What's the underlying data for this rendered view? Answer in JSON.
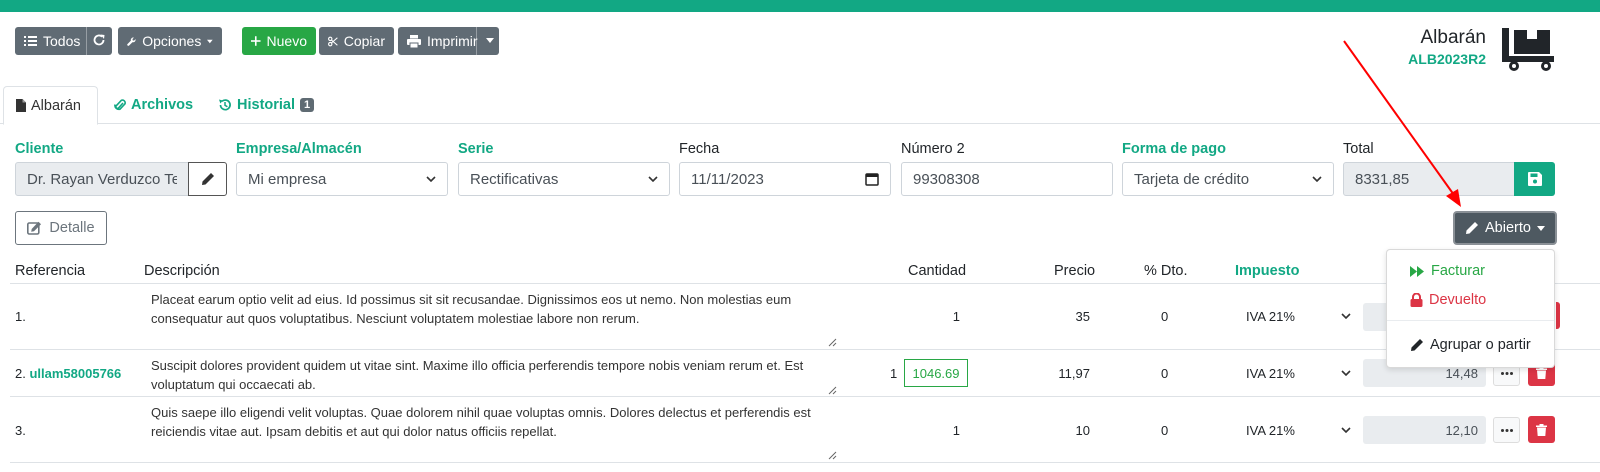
{
  "toolbar": {
    "all_label": "Todos",
    "options_label": "Opciones",
    "new_label": "Nuevo",
    "copy_label": "Copiar",
    "print_label": "Imprimir"
  },
  "document": {
    "type": "Albarán",
    "code": "ALB2023R2"
  },
  "tabs": [
    {
      "label": "Albarán"
    },
    {
      "label": "Archivos"
    },
    {
      "label": "Historial",
      "badge": "1"
    }
  ],
  "form": {
    "cliente_label": "Cliente",
    "cliente_value": "Dr. Rayan Verduzco Te",
    "empresa_label": "Empresa/Almacén",
    "empresa_value": "Mi empresa",
    "serie_label": "Serie",
    "serie_value": "Rectificativas",
    "fecha_label": "Fecha",
    "fecha_value": "11/11/2023",
    "numero2_label": "Número 2",
    "numero2_value": "99308308",
    "pago_label": "Forma de pago",
    "pago_value": "Tarjeta de crédito",
    "total_label": "Total",
    "total_value": "8331,85"
  },
  "detalle_label": "Detalle",
  "status_label": "Abierto",
  "columns": {
    "referencia": "Referencia",
    "descripcion": "Descripción",
    "cantidad": "Cantidad",
    "precio": "Precio",
    "dto": "% Dto.",
    "impuesto": "Impuesto"
  },
  "lines": [
    {
      "index": "1.",
      "ref": "",
      "desc": "Placeat earum optio velit ad eius. Id possimus sit sit recusandae. Dignissimos eos ut nemo. Non molestias eum consequatur aut quos voluptatibus. Nesciunt voluptatem molestiae labore non rerum.",
      "cantidad": "1",
      "precio": "35",
      "dto": "0",
      "impuesto": "IVA 21%",
      "total": ""
    },
    {
      "index": "2.",
      "ref": "ullam58005766",
      "desc": "Suscipit dolores provident quidem ut vitae sint. Maxime illo officia perferendis tempore nobis veniam rerum et. Est voluptatum qui occaecati ab.",
      "cantidad": "1",
      "stock": "1046.69",
      "precio": "11,97",
      "dto": "0",
      "impuesto": "IVA 21%",
      "total": "14,48"
    },
    {
      "index": "3.",
      "ref": "",
      "desc": "Quis saepe illo eligendi velit voluptas. Quae dolorem nihil quae voluptas omnis. Dolores delectus et perferendis est reiciendis vitae aut. Ipsam debitis et aut qui dolor natus officiis repellat.",
      "cantidad": "1",
      "precio": "10",
      "dto": "0",
      "impuesto": "IVA 21%",
      "total": "12,10"
    }
  ],
  "dropdown": {
    "facturar": "Facturar",
    "devuelto": "Devuelto",
    "agrupar": "Agrupar o partir"
  },
  "colors": {
    "accent": "#12a884",
    "danger": "#dc3545",
    "success": "#28a745",
    "gray_button": "#606b74",
    "annotation_arrow": "#ff0000"
  }
}
